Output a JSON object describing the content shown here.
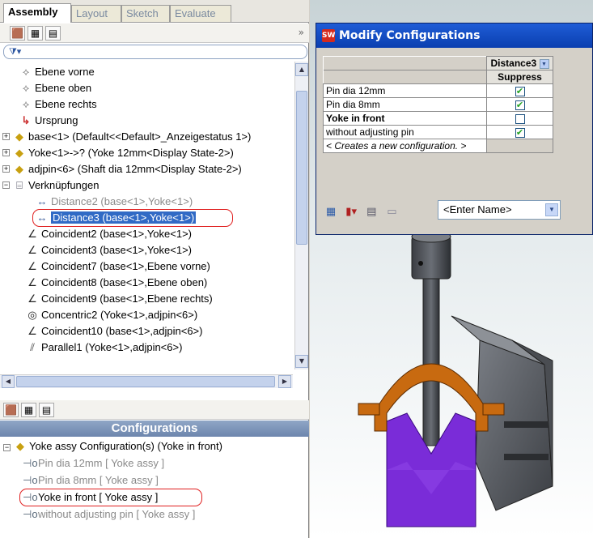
{
  "tabs": [
    "Assembly",
    "Layout",
    "Sketch",
    "Evaluate"
  ],
  "tree": [
    {
      "label": "Ebene vorne",
      "icon": "plane-icon",
      "style": "normal"
    },
    {
      "label": "Ebene oben",
      "icon": "plane-icon",
      "style": "normal"
    },
    {
      "label": "Ebene rechts",
      "icon": "plane-icon",
      "style": "normal"
    },
    {
      "label": "Ursprung",
      "icon": "origin-icon",
      "style": "normal"
    },
    {
      "label": "base<1> (Default<<Default>_Anzeigestatus 1>)",
      "icon": "part-icon",
      "style": "normal"
    },
    {
      "label": "Yoke<1>->? (Yoke 12mm<Display State-2>)",
      "icon": "part-icon",
      "style": "normal"
    },
    {
      "label": "adjpin<6> (Shaft dia 12mm<Display State-2>)",
      "icon": "part-icon",
      "style": "normal"
    },
    {
      "label": "Verknüpfungen",
      "icon": "mates-folder-icon",
      "style": "normal"
    },
    {
      "label": "Distance2 (base<1>,Yoke<1>)",
      "icon": "distance-mate-icon",
      "style": "suppressed"
    },
    {
      "label": "Distance3 (base<1>,Yoke<1>)",
      "icon": "distance-mate-icon",
      "style": "selected"
    },
    {
      "label": "Coincident2 (base<1>,Yoke<1>)",
      "icon": "coincident-mate-icon",
      "style": "normal"
    },
    {
      "label": "Coincident3 (base<1>,Yoke<1>)",
      "icon": "coincident-mate-icon",
      "style": "normal"
    },
    {
      "label": "Coincident7 (base<1>,Ebene vorne)",
      "icon": "coincident-mate-icon",
      "style": "normal"
    },
    {
      "label": "Coincident8 (base<1>,Ebene oben)",
      "icon": "coincident-mate-icon",
      "style": "normal"
    },
    {
      "label": "Coincident9 (base<1>,Ebene rechts)",
      "icon": "coincident-mate-icon",
      "style": "normal"
    },
    {
      "label": "Concentric2 (Yoke<1>,adjpin<6>)",
      "icon": "concentric-mate-icon",
      "style": "normal"
    },
    {
      "label": "Coincident10 (base<1>,adjpin<6>)",
      "icon": "coincident-mate-icon",
      "style": "normal"
    },
    {
      "label": "Parallel1 (Yoke<1>,adjpin<6>)",
      "icon": "parallel-mate-icon",
      "style": "normal"
    }
  ],
  "config_panel": {
    "header": "Configurations",
    "root": "Yoke assy Configuration(s)  (Yoke in front)",
    "items": [
      {
        "label": "Pin dia 12mm [ Yoke assy ]",
        "active": false
      },
      {
        "label": "Pin dia 8mm [ Yoke assy ]",
        "active": false
      },
      {
        "label": "Yoke in front [ Yoke assy ]",
        "active": true
      },
      {
        "label": "without adjusting pin [ Yoke assy ]",
        "active": false
      }
    ]
  },
  "dialog": {
    "title": "Modify Configurations",
    "column": "Distance3",
    "subcolumn": "Suppress",
    "rows": [
      {
        "label": "Pin dia 12mm",
        "checked": true,
        "bold": false
      },
      {
        "label": "Pin dia 8mm",
        "checked": true,
        "bold": false
      },
      {
        "label": "Yoke in front",
        "checked": false,
        "bold": true
      },
      {
        "label": "without adjusting pin",
        "checked": true,
        "bold": false
      }
    ],
    "new_row": "< Creates a new configuration. >",
    "name_placeholder": "<Enter Name>"
  }
}
